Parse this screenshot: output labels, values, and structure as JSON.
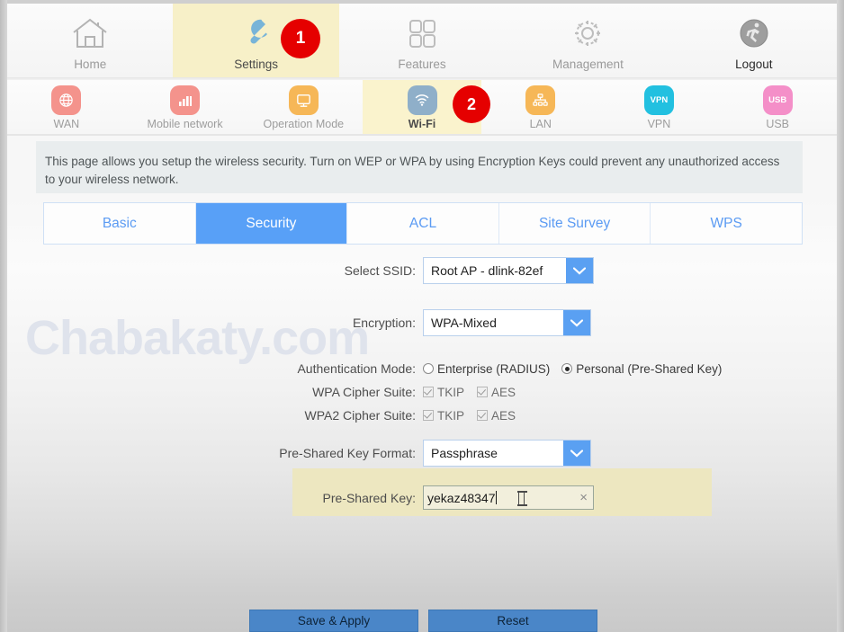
{
  "topnav": {
    "items": [
      {
        "label": "Home",
        "icon": "home-icon",
        "state": "normal"
      },
      {
        "label": "Settings",
        "icon": "wrench-icon",
        "state": "active"
      },
      {
        "label": "Features",
        "icon": "grid-icon",
        "state": "normal"
      },
      {
        "label": "Management",
        "icon": "gear-icon",
        "state": "normal"
      },
      {
        "label": "Logout",
        "icon": "logout-run-icon",
        "state": "strong"
      }
    ]
  },
  "badges": {
    "step_one": "1",
    "step_two": "2"
  },
  "subnav": {
    "items": [
      {
        "label": "WAN",
        "icon": "globe-icon",
        "color": "#f4938c",
        "state": "normal"
      },
      {
        "label": "Mobile network",
        "icon": "signal-icon",
        "color": "#f4938c",
        "state": "normal"
      },
      {
        "label": "Operation Mode",
        "icon": "monitor-icon",
        "color": "#f6b757",
        "state": "normal"
      },
      {
        "label": "Wi-Fi",
        "icon": "wifi-icon",
        "color": "#8fafc9",
        "state": "active"
      },
      {
        "label": "LAN",
        "icon": "lan-icon",
        "color": "#f6b757",
        "state": "normal"
      },
      {
        "label": "VPN",
        "icon": "vpn-icon",
        "color": "#22c0e0",
        "state": "normal",
        "glyph": "VPN"
      },
      {
        "label": "USB",
        "icon": "usb-icon",
        "color": "#f48fc8",
        "state": "normal",
        "glyph": "USB"
      }
    ]
  },
  "description": "This page allows you setup the wireless security. Turn on WEP or WPA by using Encryption Keys could prevent any unauthorized access to your wireless network.",
  "tabs": [
    {
      "label": "Basic",
      "active": false
    },
    {
      "label": "Security",
      "active": true
    },
    {
      "label": "ACL",
      "active": false
    },
    {
      "label": "Site Survey",
      "active": false
    },
    {
      "label": "WPS",
      "active": false
    }
  ],
  "form": {
    "ssid": {
      "label": "Select SSID:",
      "value": "Root AP - dlink-82ef",
      "options": [
        "Root AP - dlink-82ef"
      ]
    },
    "encryption": {
      "label": "Encryption:",
      "value": "WPA-Mixed",
      "options": [
        "WPA-Mixed"
      ]
    },
    "auth_mode": {
      "label": "Authentication Mode:",
      "options": [
        {
          "label": "Enterprise (RADIUS)",
          "selected": false
        },
        {
          "label": "Personal (Pre-Shared Key)",
          "selected": true
        }
      ]
    },
    "wpa_cipher": {
      "label": "WPA Cipher Suite:",
      "options": [
        {
          "label": "TKIP",
          "checked": true
        },
        {
          "label": "AES",
          "checked": true
        }
      ]
    },
    "wpa2_cipher": {
      "label": "WPA2 Cipher Suite:",
      "options": [
        {
          "label": "TKIP",
          "checked": true
        },
        {
          "label": "AES",
          "checked": true
        }
      ]
    },
    "psk_format": {
      "label": "Pre-Shared Key Format:",
      "value": "Passphrase",
      "options": [
        "Passphrase"
      ]
    },
    "psk": {
      "label": "Pre-Shared Key:",
      "value": "yekaz48347",
      "clear_glyph": "×"
    }
  },
  "buttons": {
    "save": "Save & Apply",
    "reset": "Reset"
  },
  "watermark": "Chabakaty.com",
  "colors": {
    "accent_blue": "#58a0f7",
    "badge_red": "#e50000",
    "highlight_yellow": "#faf3cd",
    "psk_band": "#ede7c0",
    "button_blue": "#4a86c8"
  }
}
